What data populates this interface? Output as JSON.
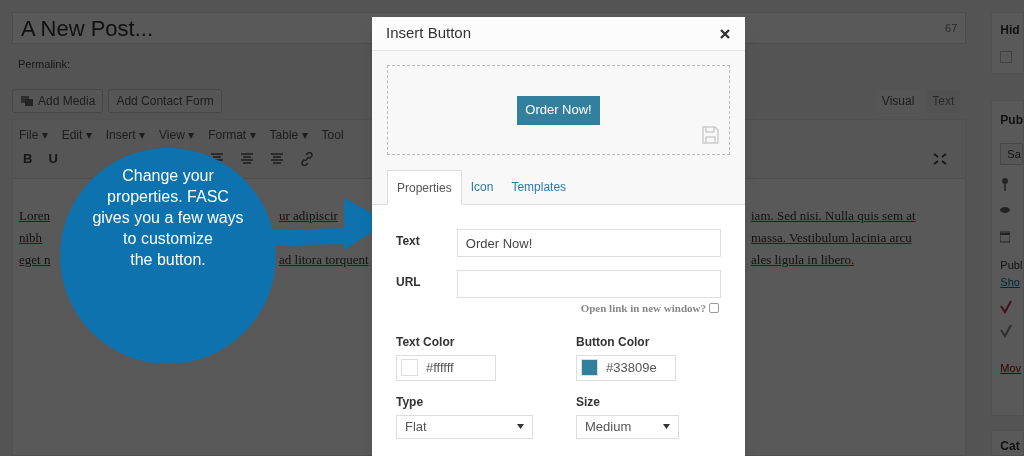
{
  "editor": {
    "title": "A New Post...",
    "count": "67",
    "permalink_label": "Permalink:",
    "media_buttons": [
      "Add Media",
      "Add Contact Form"
    ],
    "modes": [
      {
        "label": "Visual",
        "selected": true
      },
      {
        "label": "Text",
        "selected": false
      }
    ],
    "menus": [
      "File ▾",
      "Edit ▾",
      "Insert ▾",
      "View ▾",
      "Format ▾",
      "Table ▾",
      "Tool"
    ],
    "format_buttons": [
      "B",
      "U"
    ],
    "content_lines": [
      {
        "left": "Loren",
        "middle": "ur adipiscir",
        "right": "iam. Sed nisi. Nulla quis sem at"
      },
      {
        "left": "nibh",
        "right": "massa. Vestibulum lacinia arcu"
      },
      {
        "left": "eget n",
        "middle": "ad litora torquent",
        "right": "ales ligula in libero."
      }
    ]
  },
  "sidebar": {
    "hide_heading": "Hid",
    "hide_checked": false,
    "publish_heading": "Pub",
    "save_button": "Sa",
    "published_label": "Publ",
    "show_link": "Sho",
    "move_link": "Mov",
    "categories_heading": "Cat"
  },
  "callout": {
    "text": "Change your\nproperties. FASC\ngives you a few ways\nto customize\nthe button."
  },
  "modal": {
    "title": "Insert Button",
    "preview_button": "Order Now!",
    "tabs": [
      {
        "label": "Properties",
        "selected": true
      },
      {
        "label": "Icon",
        "selected": false
      },
      {
        "label": "Templates",
        "selected": false
      }
    ],
    "text_field": {
      "label": "Text",
      "value": "Order Now!"
    },
    "url_field": {
      "label": "URL"
    },
    "new_window": {
      "label": "Open link in new window?",
      "checked": false
    },
    "text_color": {
      "label": "Text Color",
      "value": "#ffffff"
    },
    "button_color": {
      "label": "Button Color",
      "value": "#33809e"
    },
    "type": {
      "label": "Type",
      "value": "Flat"
    },
    "size": {
      "label": "Size",
      "value": "Medium"
    }
  }
}
